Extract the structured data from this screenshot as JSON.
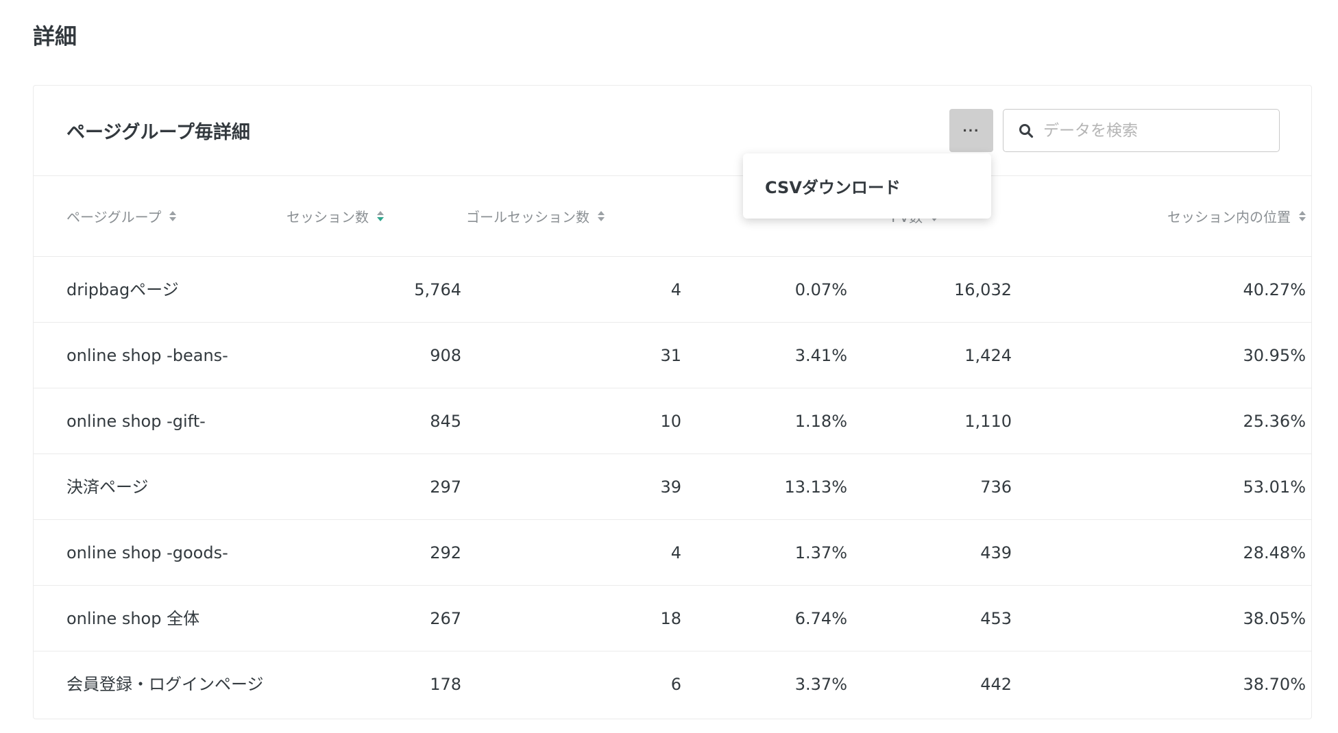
{
  "page_title": "詳細",
  "card": {
    "title": "ページグループ毎詳細",
    "more_button_label": "···",
    "search_placeholder": "データを検索"
  },
  "dropdown": {
    "items": [
      "CSVダウンロード"
    ]
  },
  "table": {
    "columns": [
      {
        "label": "ページグループ",
        "sort_active": false
      },
      {
        "label": "セッション数",
        "sort_active": true
      },
      {
        "label": "ゴールセッション数",
        "sort_active": false
      },
      {
        "label": "",
        "sort_active": false
      },
      {
        "label": "PV数",
        "sort_active": false
      },
      {
        "label": "セッション内の位置",
        "sort_active": false
      }
    ],
    "rows": [
      {
        "name": "dripbagページ",
        "sessions": "5,764",
        "goal_sessions": "4",
        "rate": "0.07%",
        "pv": "16,032",
        "position": "40.27%"
      },
      {
        "name": "online shop -beans-",
        "sessions": "908",
        "goal_sessions": "31",
        "rate": "3.41%",
        "pv": "1,424",
        "position": "30.95%"
      },
      {
        "name": "online shop -gift-",
        "sessions": "845",
        "goal_sessions": "10",
        "rate": "1.18%",
        "pv": "1,110",
        "position": "25.36%"
      },
      {
        "name": "決済ページ",
        "sessions": "297",
        "goal_sessions": "39",
        "rate": "13.13%",
        "pv": "736",
        "position": "53.01%"
      },
      {
        "name": "online shop -goods-",
        "sessions": "292",
        "goal_sessions": "4",
        "rate": "1.37%",
        "pv": "439",
        "position": "28.48%"
      },
      {
        "name": "online shop 全体",
        "sessions": "267",
        "goal_sessions": "18",
        "rate": "6.74%",
        "pv": "453",
        "position": "38.05%"
      },
      {
        "name": "会員登録・ログインページ",
        "sessions": "178",
        "goal_sessions": "6",
        "rate": "3.37%",
        "pv": "442",
        "position": "38.70%"
      }
    ]
  },
  "colors": {
    "accent": "#2fa58d",
    "border": "#ebebeb",
    "header_text": "#8a8f93"
  }
}
